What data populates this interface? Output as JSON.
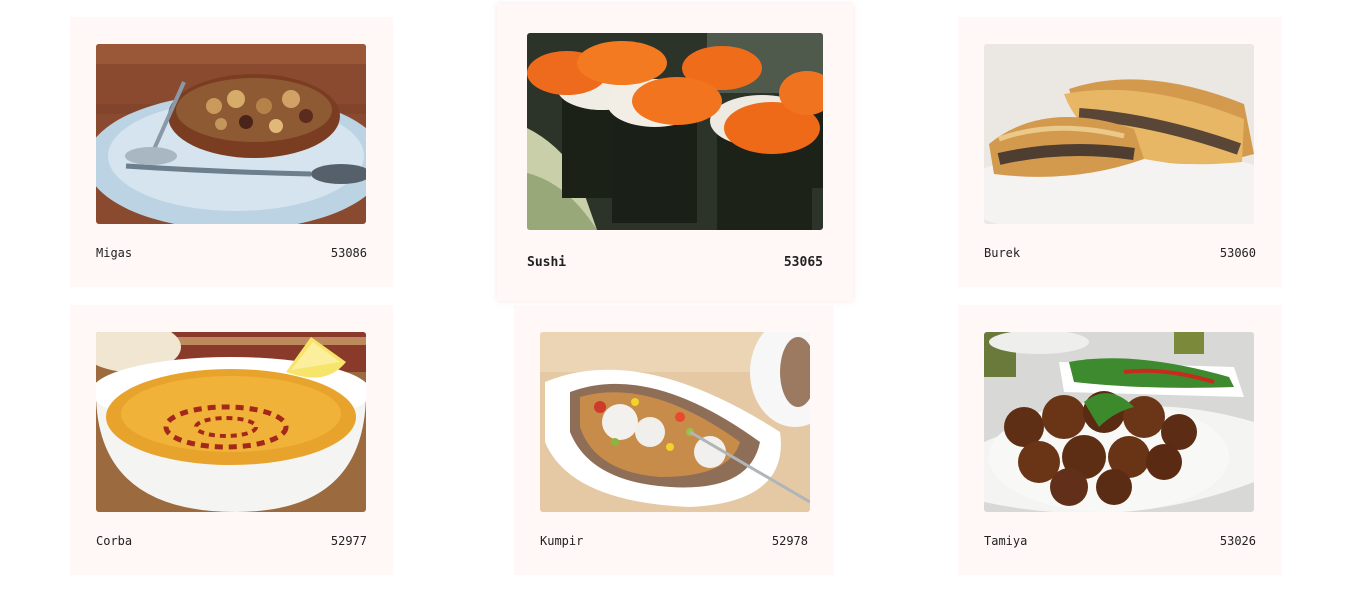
{
  "items": [
    {
      "name": "Migas",
      "id": "53086",
      "image": "migas-photo"
    },
    {
      "name": "Sushi",
      "id": "53065",
      "image": "sushi-photo"
    },
    {
      "name": "Burek",
      "id": "53060",
      "image": "burek-photo"
    },
    {
      "name": "Corba",
      "id": "52977",
      "image": "corba-photo"
    },
    {
      "name": "Kumpir",
      "id": "52978",
      "image": "kumpir-photo"
    },
    {
      "name": "Tamiya",
      "id": "53026",
      "image": "tamiya-photo"
    }
  ]
}
